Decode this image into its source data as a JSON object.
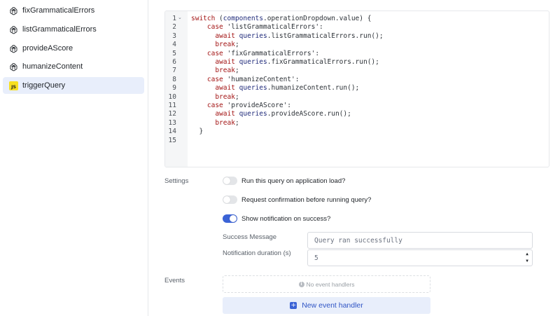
{
  "sidebar": {
    "items": [
      {
        "label": "fixGrammaticalErrors",
        "icon": "openai-icon"
      },
      {
        "label": "listGrammaticalErrors",
        "icon": "openai-icon"
      },
      {
        "label": "provideAScore",
        "icon": "openai-icon"
      },
      {
        "label": "humanizeContent",
        "icon": "openai-icon"
      },
      {
        "label": "triggerQuery",
        "icon": "js-icon",
        "badge": "JS",
        "active": true
      }
    ]
  },
  "editor": {
    "line_numbers": [
      "1",
      "2",
      "3",
      "4",
      "5",
      "6",
      "7",
      "8",
      "9",
      "10",
      "11",
      "12",
      "13",
      "14",
      "15"
    ],
    "lines": [
      "switch (components.operationDropdown.value) {",
      "    case 'listGrammaticalErrors':",
      "      await queries.listGrammaticalErrors.run();",
      "      break;",
      "    case 'fixGrammaticalErrors':",
      "      await queries.fixGrammaticalErrors.run();",
      "      break;",
      "    case 'humanizeContent':",
      "      await queries.humanizeContent.run();",
      "      break;",
      "    case 'provideAScore':",
      "      await queries.provideAScore.run();",
      "      break;",
      "  }",
      ""
    ]
  },
  "settings": {
    "label": "Settings",
    "toggles": [
      {
        "label": "Run this query on application load?",
        "on": false
      },
      {
        "label": "Request confirmation before running query?",
        "on": false
      },
      {
        "label": "Show notification on success?",
        "on": true
      }
    ],
    "success_message_label": "Success Message",
    "success_message_placeholder": "Query ran successfully",
    "notification_duration_label": "Notification duration (s)",
    "notification_duration_value": "5"
  },
  "events": {
    "label": "Events",
    "empty_text": "No event handlers",
    "new_handler_label": "New event handler"
  },
  "colors": {
    "accent": "#3b63d6",
    "active_bg": "#e8eefb",
    "keyword": "#a31515",
    "js_badge": "#f7df1e"
  }
}
